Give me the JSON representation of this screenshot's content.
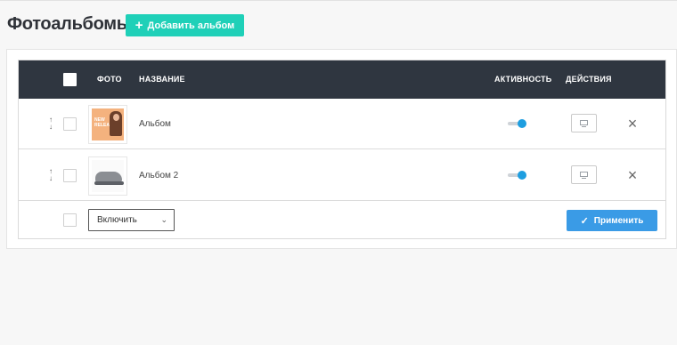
{
  "header": {
    "title": "Фотоальбомы",
    "add_button_label": "Добавить альбом",
    "add_icon": "plus-icon"
  },
  "table": {
    "columns": {
      "photo": "Фото",
      "name": "Название",
      "active": "Активность",
      "actions": "Действия"
    },
    "rows": [
      {
        "name": "Альбом",
        "active": true,
        "thumb_caption": "NEW RELEASES"
      },
      {
        "name": "Альбом 2",
        "active": true
      }
    ]
  },
  "footer": {
    "action_select_value": "Включить",
    "apply_label": "Применить",
    "apply_icon": "check-icon"
  },
  "colors": {
    "accent_teal": "#1fd0b8",
    "header_dark": "#2f3640",
    "toggle_on": "#1e9ee0",
    "apply_blue": "#3a9be6"
  }
}
